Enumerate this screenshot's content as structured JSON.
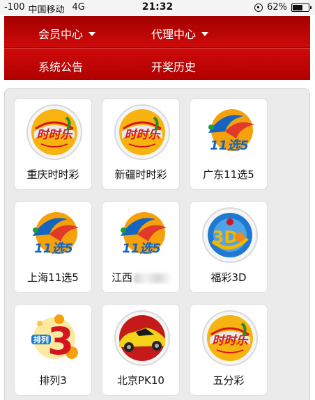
{
  "status_bar": {
    "signal": "-100",
    "carrier": "中国移动",
    "network": "4G",
    "time": "21:32",
    "battery": "62%",
    "battery_level": 0.62
  },
  "menu": {
    "member_center": "会员中心",
    "agent_center": "代理中心",
    "announcements": "系统公告",
    "draw_history": "开奖历史"
  },
  "games": [
    {
      "label": "重庆时时彩",
      "icon": "shishicai-logo"
    },
    {
      "label": "新疆时时彩",
      "icon": "shishicai-logo"
    },
    {
      "label": "广东11选5",
      "icon": "11xuan5-logo"
    },
    {
      "label": "上海11选5",
      "icon": "11xuan5-logo"
    },
    {
      "label": "江西",
      "icon": "11xuan5-logo"
    },
    {
      "label": "福彩3D",
      "icon": "fucai3d-logo"
    },
    {
      "label": "排列3",
      "icon": "pailie3-logo"
    },
    {
      "label": "北京PK10",
      "icon": "race-car-logo"
    },
    {
      "label": "五分彩",
      "icon": "shishicai-logo"
    }
  ],
  "colors": {
    "menu_red": "#c80000",
    "panel_bg": "#ebebeb",
    "logo_orange": "#f5a10b",
    "logo_red": "#d6141d",
    "logo_blue": "#1564c0"
  }
}
